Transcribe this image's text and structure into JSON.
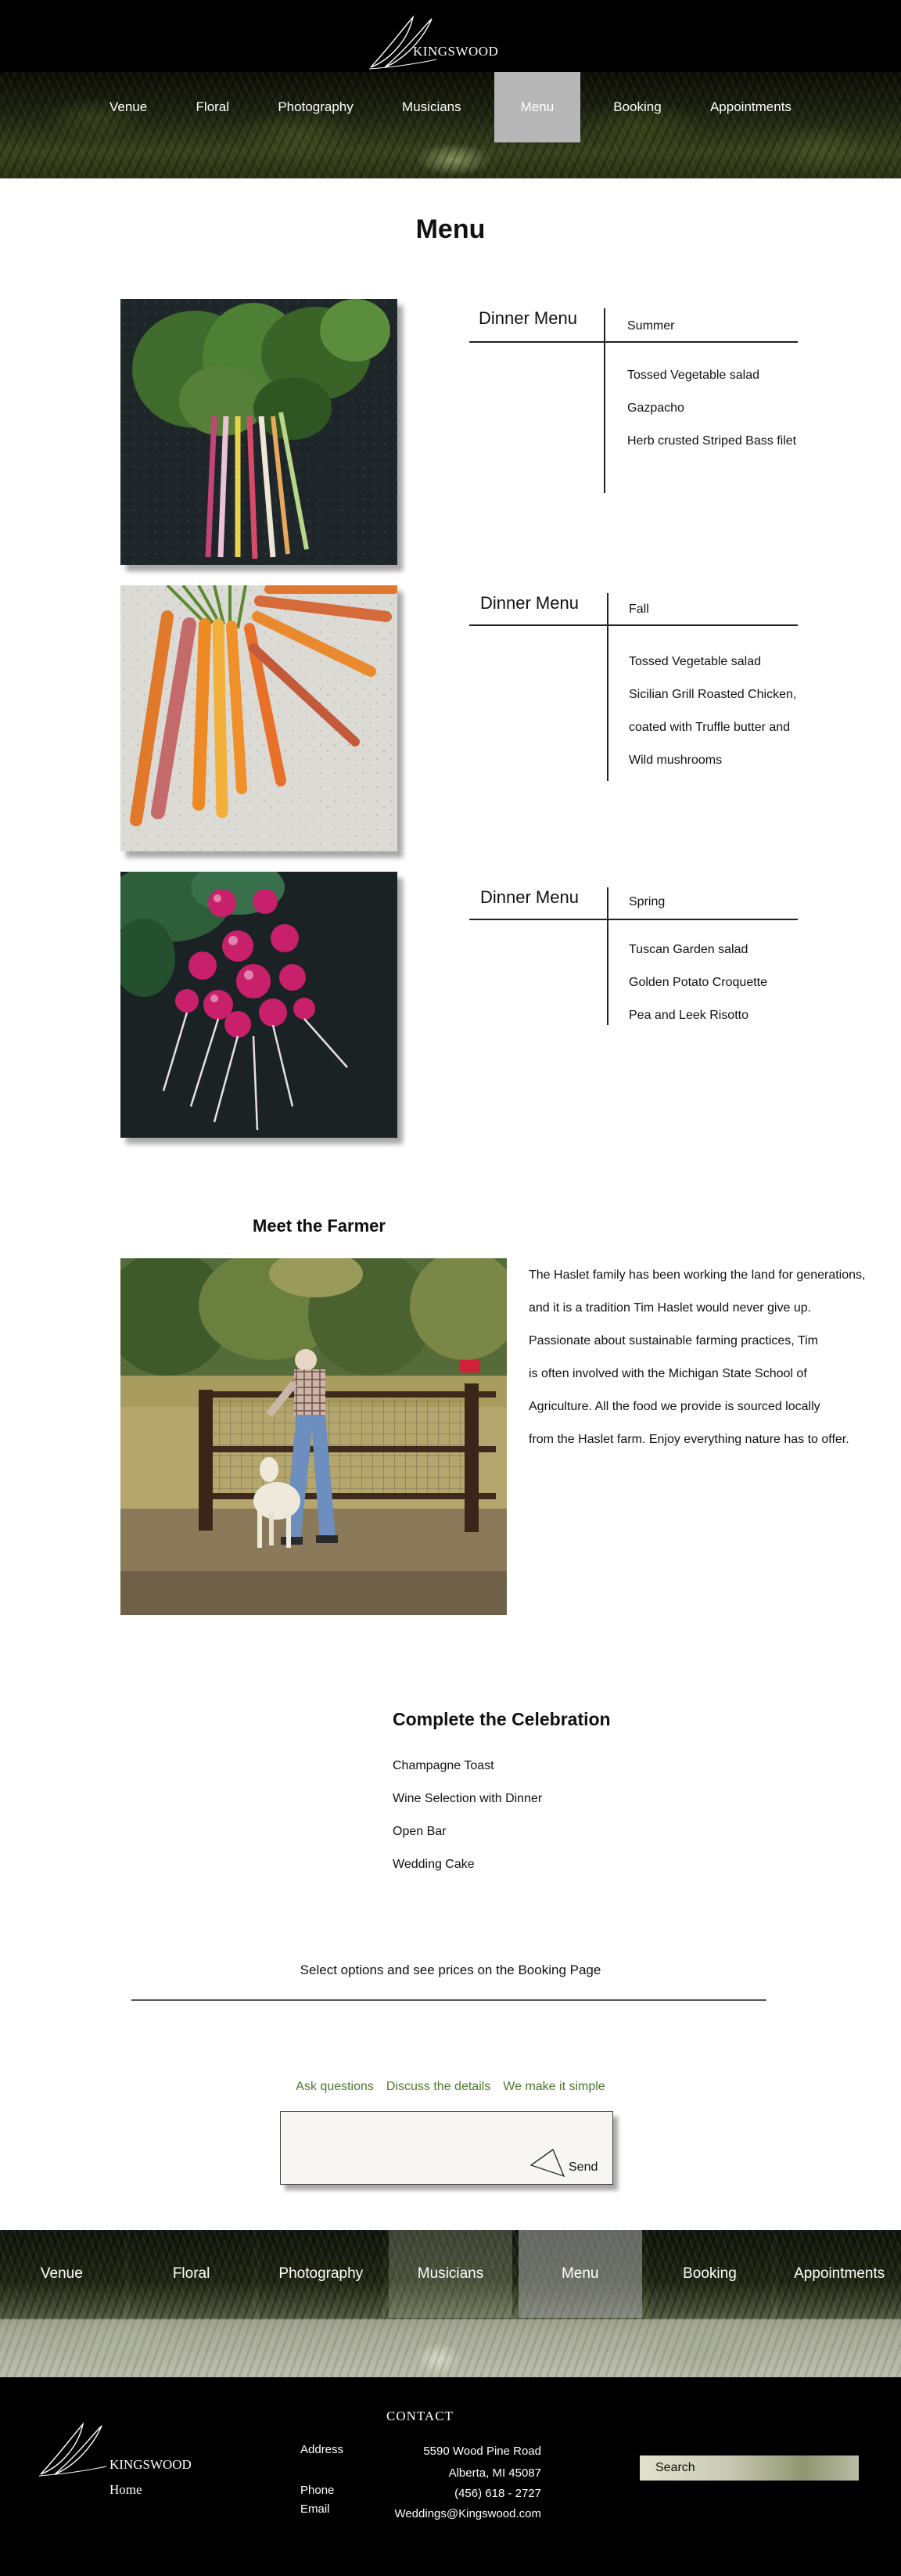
{
  "header": {
    "brand": "KINGSWOOD",
    "nav": [
      {
        "label": "Venue",
        "active": false
      },
      {
        "label": "Floral",
        "active": false
      },
      {
        "label": "Photography",
        "active": false
      },
      {
        "label": "Musicians",
        "active": false
      },
      {
        "label": "Menu",
        "active": true
      },
      {
        "label": "Booking",
        "active": false
      },
      {
        "label": "Appointments",
        "active": false
      }
    ]
  },
  "page_title": "Menu",
  "menus": [
    {
      "title": "Dinner Menu",
      "season": "Summer",
      "items": [
        "Tossed Vegetable salad",
        "Gazpacho",
        "Herb crusted Striped Bass filet"
      ]
    },
    {
      "title": "Dinner Menu",
      "season": "Fall",
      "items": [
        "Tossed Vegetable salad",
        "Sicilian Grill Roasted Chicken,",
        "coated with Truffle butter and",
        "Wild mushrooms"
      ]
    },
    {
      "title": "Dinner Menu",
      "season": "Spring",
      "items": [
        "Tuscan Garden salad",
        "Golden Potato Croquette",
        "Pea and Leek Risotto"
      ]
    }
  ],
  "farmer": {
    "title": "Meet the Farmer",
    "lines": [
      "The Haslet family has been working the land for generations,",
      "and it is a tradition Tim Haslet would never give up.",
      "Passionate about sustainable farming practices, Tim",
      "is often involved with the Michigan State School of",
      "Agriculture. All the food we provide is sourced locally",
      "from the Haslet farm. Enjoy everything nature has to offer."
    ]
  },
  "celebration": {
    "title": "Complete the Celebration",
    "items": [
      "Champagne Toast",
      "Wine Selection with Dinner",
      "Open Bar",
      "Wedding Cake"
    ]
  },
  "booking_note": "Select options and see prices on the Booking Page",
  "contact_form": {
    "links": [
      "Ask questions",
      "Discuss the details",
      "We make it simple"
    ],
    "send_label": "Send"
  },
  "bottom_nav": [
    {
      "label": "Venue",
      "active": false
    },
    {
      "label": "Floral",
      "active": false
    },
    {
      "label": "Photography",
      "active": false
    },
    {
      "label": "Musicians",
      "active": false
    },
    {
      "label": "Menu",
      "active": true
    },
    {
      "label": "Booking",
      "active": false
    },
    {
      "label": "Appointments",
      "active": false
    }
  ],
  "footer": {
    "brand": "KINGSWOOD",
    "home": "Home",
    "contact_heading": "CONTACT",
    "address_label": "Address",
    "address_line1": "5590 Wood Pine Road",
    "address_line2": "Alberta, MI 45087",
    "phone_label": "Phone",
    "phone": "(456) 618 - 2727",
    "email_label": "Email",
    "email": "Weddings@Kingswood.com",
    "search_label": "Search"
  },
  "colors": {
    "accent_green": "#4c7a2c",
    "active_nav": "#b7b7b7",
    "header_bg": "#000000"
  }
}
